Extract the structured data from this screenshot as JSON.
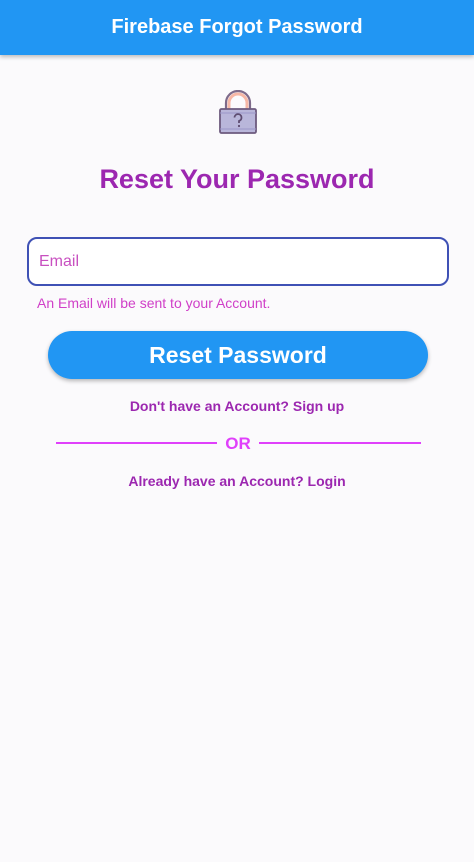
{
  "appbar": {
    "title": "Firebase Forgot Password"
  },
  "icons": {
    "lock": "lock-question-icon"
  },
  "heading": "Reset Your Password",
  "email": {
    "placeholder": "Email",
    "value": "",
    "helper": "An Email will be sent to your Account."
  },
  "reset_button": {
    "label": "Reset Password"
  },
  "signup": {
    "label": "Don't have an Account? Sign up"
  },
  "divider": {
    "label": "OR"
  },
  "login": {
    "label": "Already have an Account? Login"
  },
  "colors": {
    "primary": "#2196f3",
    "purple": "#9c27b0",
    "accent_pink": "#e040fb",
    "field_border": "#3f51b5"
  }
}
